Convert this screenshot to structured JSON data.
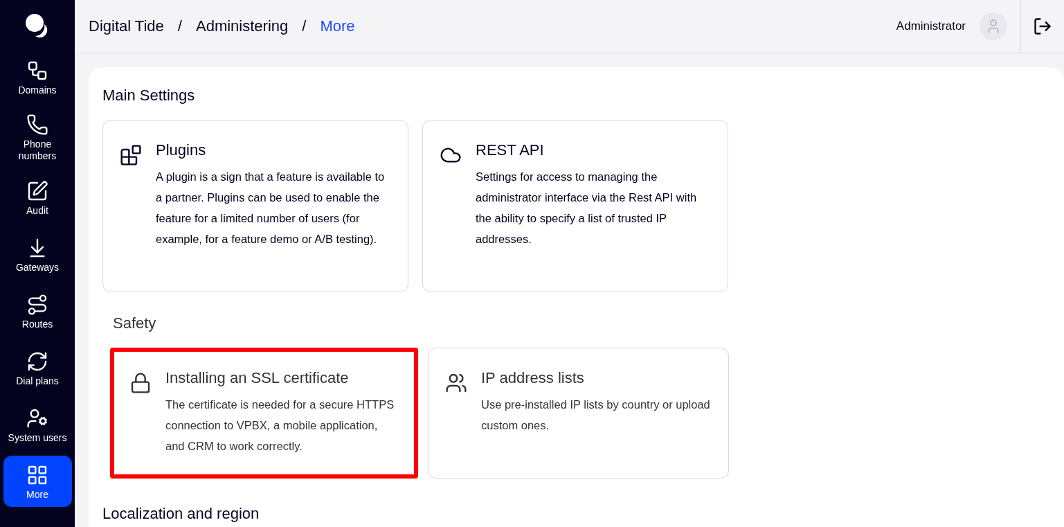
{
  "sidebar": {
    "items": [
      {
        "label": "Domains",
        "selected": false
      },
      {
        "label": "Phone numbers",
        "selected": false
      },
      {
        "label": "Audit",
        "selected": false
      },
      {
        "label": "Gateways",
        "selected": false
      },
      {
        "label": "Routes",
        "selected": false
      },
      {
        "label": "Dial plans",
        "selected": false
      },
      {
        "label": "System users",
        "selected": false
      },
      {
        "label": "More",
        "selected": true
      }
    ]
  },
  "breadcrumbs": [
    {
      "label": "Digital Tide",
      "current": false
    },
    {
      "label": "Administering",
      "current": false
    },
    {
      "label": "More",
      "current": true
    }
  ],
  "breadcrumb_separator": "/",
  "user": {
    "name": "Administrator"
  },
  "sections": [
    {
      "title": "Main Settings",
      "cards": [
        {
          "title": "Plugins",
          "description": "A plugin is a sign that a feature is available to a partner. Plugins can be used to enable the feature for a limited number of users (for example, for a feature demo or A/B testing).",
          "highlighted": false
        },
        {
          "title": "REST API",
          "description": "Settings for access to managing the administrator interface via the Rest API with the ability to specify a list of trusted IP addresses.",
          "highlighted": false
        }
      ]
    },
    {
      "title": "Safety",
      "cards": [
        {
          "title": "Installing an SSL certificate",
          "description": "The certificate is needed for a secure HTTPS connection to VPBX, a mobile application, and CRM to work correctly.",
          "highlighted": true
        },
        {
          "title": "IP address lists",
          "description": "Use pre-installed IP lists by country or upload custom ones.",
          "highlighted": false
        }
      ]
    },
    {
      "title": "Localization and region"
    }
  ]
}
